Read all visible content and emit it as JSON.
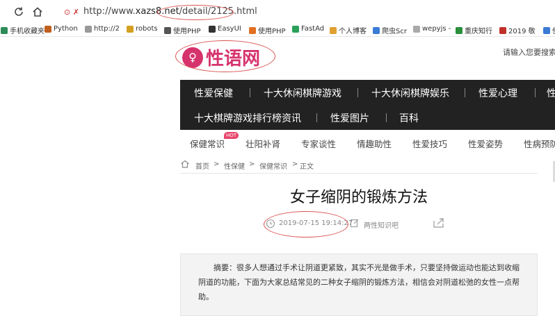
{
  "browser": {
    "url_prefix": "http://www.",
    "url_host": "xazs8.net",
    "url_path": "/detail/2125.html",
    "url_icons": "⊙ ✗"
  },
  "bookmarks": [
    {
      "label": "手机收藏夹",
      "color": "#2e8b57"
    },
    {
      "label": "Python",
      "color": "#c06020"
    },
    {
      "label": "http://2",
      "color": "#999999"
    },
    {
      "label": "robots",
      "color": "#d4a020"
    },
    {
      "label": "使用PHP",
      "color": "#555555"
    },
    {
      "label": "EasyUI",
      "color": "#333333"
    },
    {
      "label": "使用PHP",
      "color": "#e07020"
    },
    {
      "label": "FastAd",
      "color": "#2aa05a"
    },
    {
      "label": "个人博客",
      "color": "#e0a030"
    },
    {
      "label": "爬虫Scr",
      "color": "#3a7bd5"
    },
    {
      "label": "wepyjs -",
      "color": "#aaaaaa"
    },
    {
      "label": "重庆知行",
      "color": "#2a8f3a"
    },
    {
      "label": "2019 敬",
      "color": "#c0302a"
    },
    {
      "label": "使",
      "color": "#3a7bd5"
    }
  ],
  "site": {
    "logo_text": "性语网",
    "logo_mark": "♀",
    "search_hint": "请输入您要搜索"
  },
  "nav": {
    "row1": [
      "性爱保健",
      "十大休闲棋牌游戏",
      "十大休闲棋牌娱乐",
      "性爱心理",
      "性"
    ],
    "row2": [
      "十大棋牌游戏排行榜资讯",
      "性爱图片",
      "百科"
    ]
  },
  "subnav": {
    "items": [
      "保健常识",
      "壮阳补肾",
      "专家谈性",
      "情趣助性",
      "性爱技巧",
      "性爱姿势",
      "性病预防"
    ],
    "hot_badge": "HOT"
  },
  "breadcrumb": {
    "items": [
      "首页",
      "性保健",
      "保健常识",
      "正文"
    ],
    "sep": ">"
  },
  "article": {
    "title": "女子缩阴的锻炼方法",
    "datetime": "2019-07-15 19:14:27",
    "author": "两性知识吧",
    "summary": "摘要：很多人想通过手术让阴道更紧致，其实不光是做手术，只要坚持做运动也能达到收缩阴道的功能，下面为大家总结常见的二种女子缩阴的锻炼方法，相信会对阴道松弛的女性一点帮助。"
  },
  "colors": {
    "annotation": "#d9534f",
    "brand": "#d6336c",
    "nav_bg": "#222222"
  }
}
